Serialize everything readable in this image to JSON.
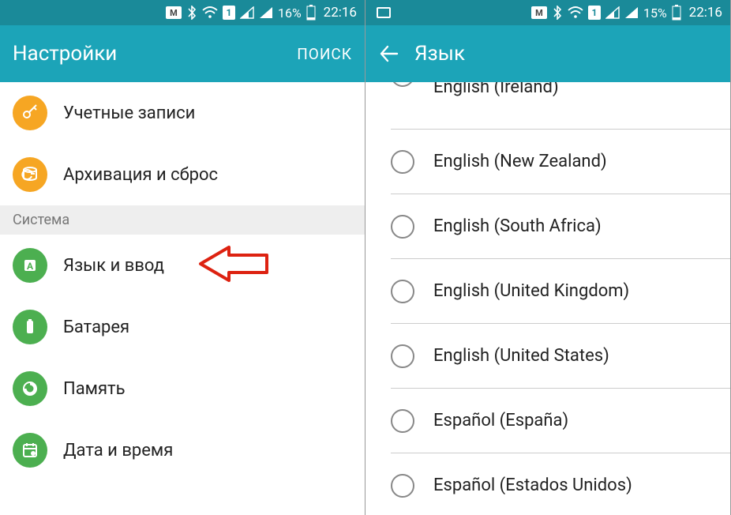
{
  "left": {
    "status": {
      "sim": "1",
      "battery_pct": "16%",
      "time": "22:16"
    },
    "appbar": {
      "title": "Настройки",
      "action": "ПОИСК"
    },
    "rows_top": [
      {
        "label": "Учетные записи",
        "color": "orange",
        "icon": "key"
      },
      {
        "label": "Архивация и сброс",
        "color": "orange",
        "icon": "backup"
      }
    ],
    "section_label": "Система",
    "rows_bottom": [
      {
        "label": "Язык и ввод",
        "color": "green",
        "icon": "globe",
        "highlight": true
      },
      {
        "label": "Батарея",
        "color": "green",
        "icon": "battery"
      },
      {
        "label": "Память",
        "color": "green",
        "icon": "storage"
      },
      {
        "label": "Дата и время",
        "color": "green",
        "icon": "calendar"
      }
    ]
  },
  "right": {
    "status": {
      "sim": "1",
      "battery_pct": "15%",
      "time": "22:16"
    },
    "appbar": {
      "title": "Язык"
    },
    "languages": [
      "English (Ireland)",
      "English (New Zealand)",
      "English (South Africa)",
      "English (United Kingdom)",
      "English (United States)",
      "Español (España)",
      "Español (Estados Unidos)"
    ]
  }
}
